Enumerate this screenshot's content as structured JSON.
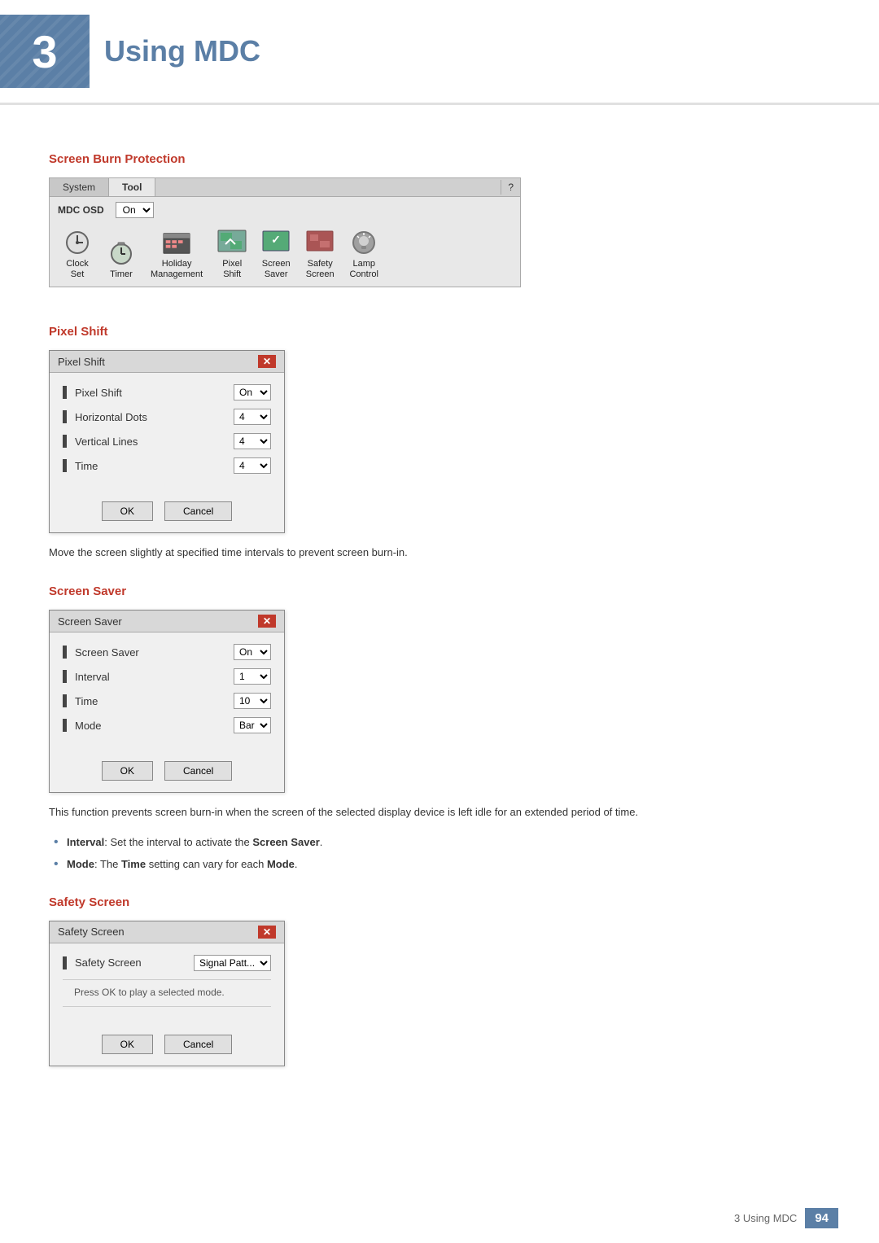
{
  "chapter": {
    "number": "3",
    "title": "Using MDC"
  },
  "section_burn": {
    "heading": "Screen Burn Protection"
  },
  "toolbar": {
    "tabs": [
      "System",
      "Tool"
    ],
    "active_tab": "Tool",
    "question_icon": "?",
    "mdc_osd_label": "MDC OSD",
    "mdc_osd_value": "On",
    "icons": [
      {
        "label": "Clock\nSet",
        "id": "clock-set"
      },
      {
        "label": "Timer",
        "id": "timer"
      },
      {
        "label": "Holiday\nManagement",
        "id": "holiday-management"
      },
      {
        "label": "Pixel\nShift",
        "id": "pixel-shift"
      },
      {
        "label": "Screen\nSaver",
        "id": "screen-saver"
      },
      {
        "label": "Safety\nScreen",
        "id": "safety-screen"
      },
      {
        "label": "Lamp\nControl",
        "id": "lamp-control"
      }
    ]
  },
  "pixel_shift": {
    "section_heading": "Pixel Shift",
    "dialog_title": "Pixel Shift",
    "rows": [
      {
        "label": "Pixel Shift",
        "value": "On"
      },
      {
        "label": "Horizontal Dots",
        "value": "4"
      },
      {
        "label": "Vertical Lines",
        "value": "4"
      },
      {
        "label": "Time",
        "value": "4"
      }
    ],
    "ok_label": "OK",
    "cancel_label": "Cancel",
    "description": "Move the screen slightly at specified time intervals to prevent screen burn-in."
  },
  "screen_saver": {
    "section_heading": "Screen Saver",
    "dialog_title": "Screen Saver",
    "rows": [
      {
        "label": "Screen Saver",
        "value": "On"
      },
      {
        "label": "Interval",
        "value": "1"
      },
      {
        "label": "Time",
        "value": "10"
      },
      {
        "label": "Mode",
        "value": "Bar"
      }
    ],
    "ok_label": "OK",
    "cancel_label": "Cancel",
    "description": "This function prevents screen burn-in when the screen of the selected display device is left idle for an extended period of time.",
    "bullets": [
      {
        "key": "Interval",
        "text": ": Set the interval to activate the ",
        "bold_word": "Screen Saver",
        "suffix": "."
      },
      {
        "key": "Mode",
        "text": ": The ",
        "bold_word": "Time",
        "middle": " setting can vary for each ",
        "bold_word2": "Mode",
        "suffix": "."
      }
    ]
  },
  "safety_screen": {
    "section_heading": "Safety Screen",
    "dialog_title": "Safety Screen",
    "rows": [
      {
        "label": "Safety Screen",
        "value": "Signal Patt..."
      }
    ],
    "info_text": "Press OK to play a selected mode.",
    "ok_label": "OK",
    "cancel_label": "Cancel"
  },
  "footer": {
    "chapter_label": "3 Using MDC",
    "page_number": "94"
  }
}
